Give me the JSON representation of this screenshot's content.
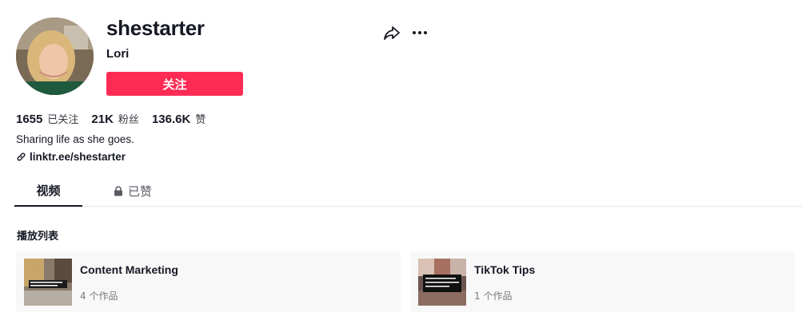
{
  "profile": {
    "username": "shestarter",
    "nickname": "Lori",
    "follow_label": "关注",
    "bio": "Sharing life as she goes.",
    "link": "linktr.ee/shestarter"
  },
  "stats": [
    {
      "value": "1655",
      "label": "已关注"
    },
    {
      "value": "21K",
      "label": "粉丝"
    },
    {
      "value": "136.6K",
      "label": "赞"
    }
  ],
  "tabs": [
    {
      "label": "视频",
      "active": true
    },
    {
      "label": "已赞",
      "locked": true
    }
  ],
  "playlists": {
    "heading": "播放列表",
    "items": [
      {
        "title": "Content Marketing",
        "count": "4 个作品"
      },
      {
        "title": "TikTok Tips",
        "count": "1 个作品"
      }
    ]
  },
  "colors": {
    "accent": "#fe2c55",
    "text": "#161823",
    "muted": "#7a7b82",
    "card_bg": "#f8f8f8"
  },
  "icons": {
    "share": "share-icon",
    "more": "more-icon",
    "link": "link-icon",
    "lock": "lock-icon"
  }
}
